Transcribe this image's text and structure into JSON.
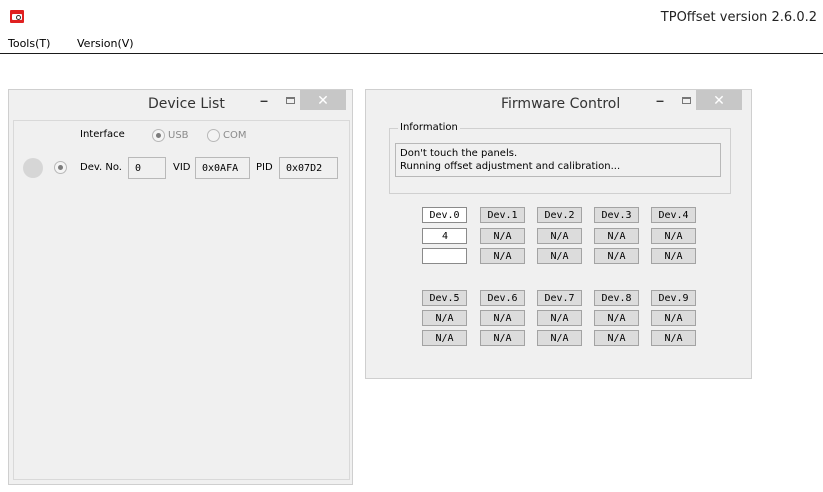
{
  "window": {
    "title": "TPOffset version 2.6.0.2"
  },
  "menubar": {
    "items": [
      "Tools(T)",
      "Version(V)"
    ]
  },
  "device_list": {
    "title": "Device List",
    "interface_label": "Interface",
    "radio_usb": "USB",
    "radio_com": "COM",
    "selected_interface": "USB",
    "dev_no_label": "Dev. No.",
    "dev_no_value": "0",
    "vid_label": "VID",
    "vid_value": "0x0AFA",
    "pid_label": "PID",
    "pid_value": "0x07D2"
  },
  "firmware_control": {
    "title": "Firmware Control",
    "info_legend": "Information",
    "info_lines": [
      "Don't touch the panels.",
      "Running offset adjustment and calibration..."
    ],
    "row1": {
      "devices": [
        "Dev.0",
        "Dev.1",
        "Dev.2",
        "Dev.3",
        "Dev.4"
      ],
      "values_a": [
        "4",
        "N/A",
        "N/A",
        "N/A",
        "N/A"
      ],
      "values_b": [
        "",
        "N/A",
        "N/A",
        "N/A",
        "N/A"
      ]
    },
    "row2": {
      "devices": [
        "Dev.5",
        "Dev.6",
        "Dev.7",
        "Dev.8",
        "Dev.9"
      ],
      "values_a": [
        "N/A",
        "N/A",
        "N/A",
        "N/A",
        "N/A"
      ],
      "values_b": [
        "N/A",
        "N/A",
        "N/A",
        "N/A",
        "N/A"
      ]
    }
  }
}
